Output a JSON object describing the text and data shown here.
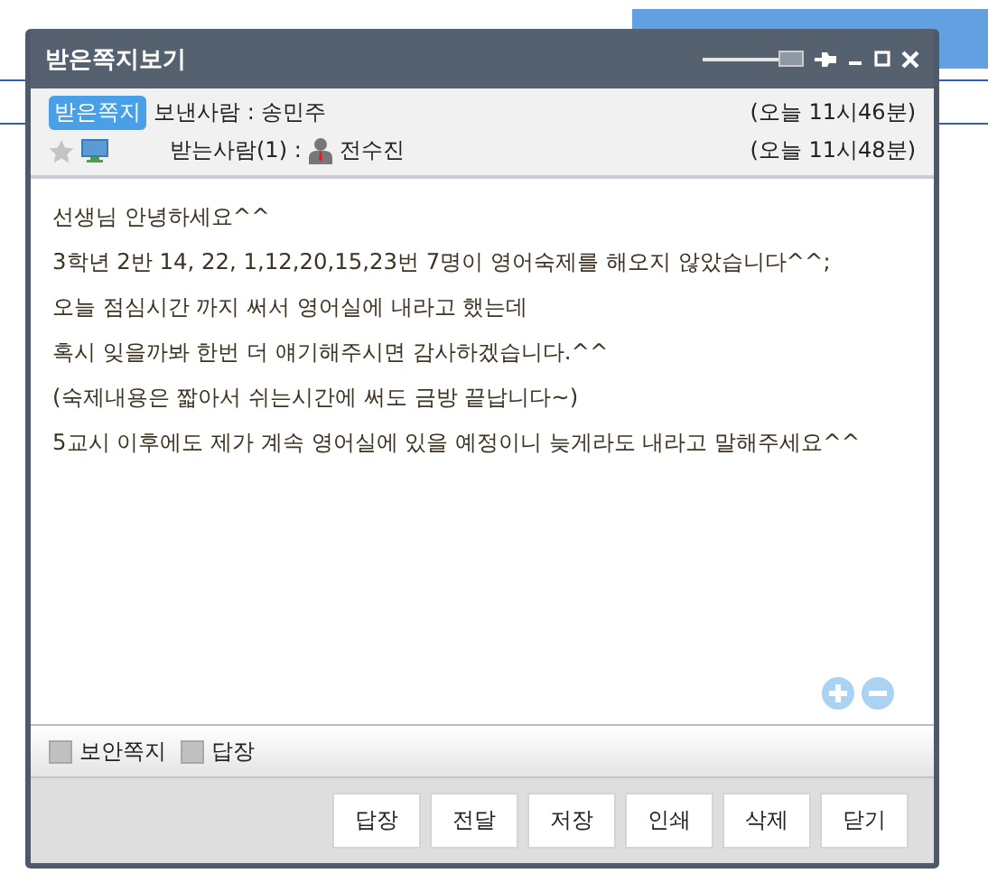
{
  "window": {
    "title": "받은쪽지보기",
    "opacity_slider": {
      "level": 1
    }
  },
  "header": {
    "badge": "받은쪽지",
    "sender_label": "보낸사람 : 송민주",
    "sent_time": "(오늘 11시46분)",
    "recipient_label": "받는사람(1) :",
    "recipient": "전수진",
    "read_time": "(오늘 11시48분)"
  },
  "message": [
    "선생님 안녕하세요^^",
    "3학년 2반 14, 22, 1,12,20,15,23번 7명이 영어숙제를 해오지 않았습니다^^;",
    "오늘 점심시간 까지 써서 영어실에 내라고 했는데",
    "혹시 잊을까봐 한번 더 얘기해주시면 감사하겠습니다.^^",
    "(숙제내용은 짧아서 쉬는시간에 써도 금방 끝납니다~)",
    "5교시 이후에도 제가 계속 영어실에 있을 예정이니 늦게라도 내라고 말해주세요^^"
  ],
  "options": [
    {
      "label": "보안쪽지",
      "checked": false
    },
    {
      "label": "답장",
      "checked": false
    }
  ],
  "buttons": [
    "답장",
    "전달",
    "저장",
    "인쇄",
    "삭제",
    "닫기"
  ]
}
